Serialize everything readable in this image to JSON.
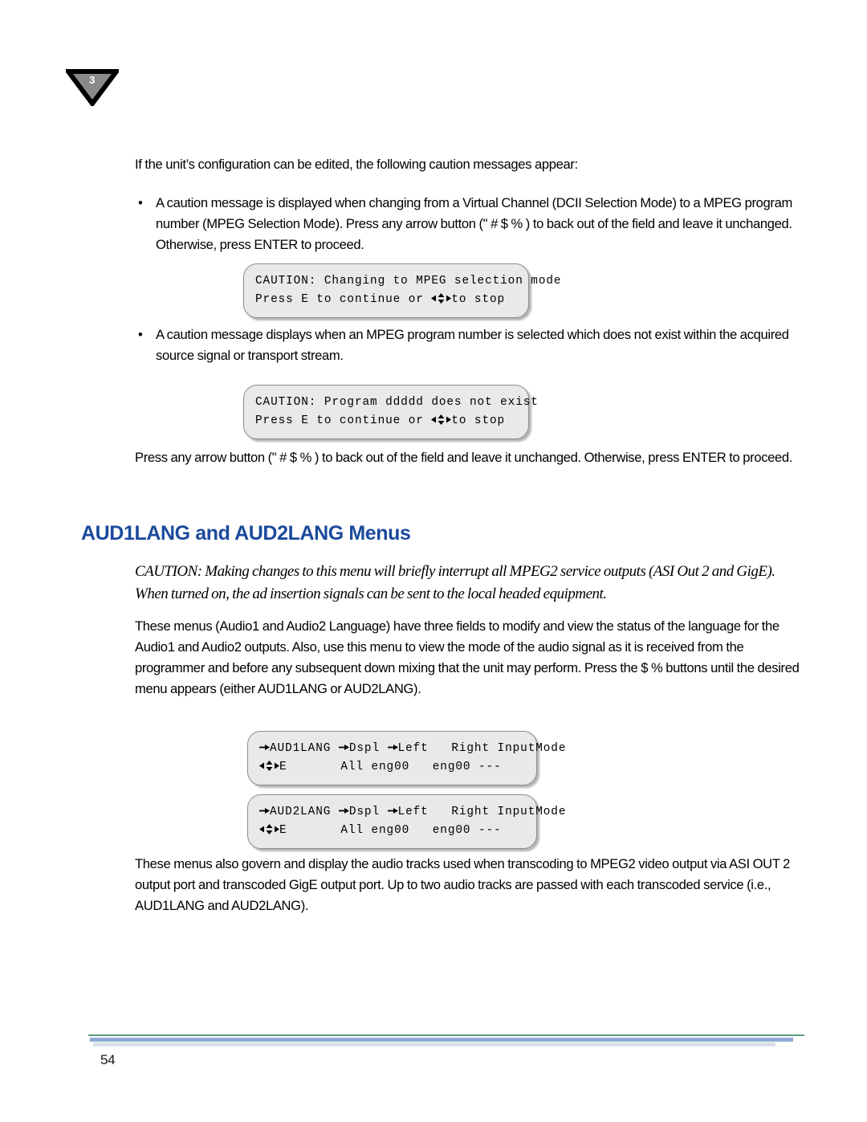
{
  "page": {
    "chapter_marker": "3",
    "page_number": "54",
    "accent_heading_color": "#1b4a9c",
    "rule_green_color": "#5f9a7e",
    "rule_blue_color": "#8facd4",
    "rule_light_color": "#d9e2ea"
  },
  "intro": {
    "lead": "If the unit’s configuration can be edited, the following caution messages appear:"
  },
  "bullets": [
    {
      "marker": "•",
      "text": "A caution message is displayed when changing from a Virtual Channel (DCII Selection Mode) to a MPEG program number (MPEG Selection Mode). Press any arrow button (\"  #  $  % ) to back out of the field and leave it unchanged. Otherwise, press ENTER to proceed."
    },
    {
      "marker": "•",
      "text": "A caution message displays when an MPEG program number is selected which does not exist within the acquired source signal or transport stream."
    }
  ],
  "lcd_caution_mpeg": {
    "line1": "CAUTION: Changing to MPEG selection mode",
    "line2_prefix": "Press E to continue or ",
    "line2_suffix": "to stop"
  },
  "lcd_caution_program": {
    "line1": "CAUTION: Program ddddd does not exist",
    "line2_prefix": "Press E to continue or ",
    "line2_suffix": "to stop"
  },
  "arrow_para": {
    "text": "Press any arrow button (\"  #  $  % ) to back out of the field and leave it unchanged. Otherwise, press ENTER to proceed."
  },
  "section": {
    "heading": "AUD1LANG and AUD2LANG Menus",
    "caution_note": "CAUTION:  Making changes to this menu will briefly interrupt all MPEG2 service outputs (ASI Out 2 and GigE). When turned on, the ad insertion signals can be sent to the local headed equipment.",
    "paragraph": "These menus (Audio1 and Audio2 Language) have three fields to modify and view the status of the language for the Audio1 and Audio2 outputs. Also, use this menu to view the mode of the audio signal as it is received from the programmer and before any subsequent down mixing that the unit may perform. Press the $  %  buttons until the desired menu appears (either AUD1LANG or AUD2LANG).",
    "closing_paragraph": "These menus also govern and display the audio tracks used when transcoding to MPEG2 video output via ASI OUT 2 output port and transcoded GigE output port. Up to two audio tracks are passed with each transcoded service (i.e., AUD1LANG and AUD2LANG)."
  },
  "lcd_aud1lang": {
    "label": "AUD1LANG",
    "col_dspl": "Dspl",
    "col_left": "Left",
    "col_right": "Right",
    "col_inputmode": "InputMode",
    "row2_enter": "E",
    "val_dspl": "All",
    "val_left": "eng00",
    "val_right": "eng00",
    "val_inputmode": "---"
  },
  "lcd_aud2lang": {
    "label": "AUD2LANG",
    "col_dspl": "Dspl",
    "col_left": "Left",
    "col_right": "Right",
    "col_inputmode": "InputMode",
    "row2_enter": "E",
    "val_dspl": "All",
    "val_left": "eng00",
    "val_right": "eng00",
    "val_inputmode": "---"
  }
}
